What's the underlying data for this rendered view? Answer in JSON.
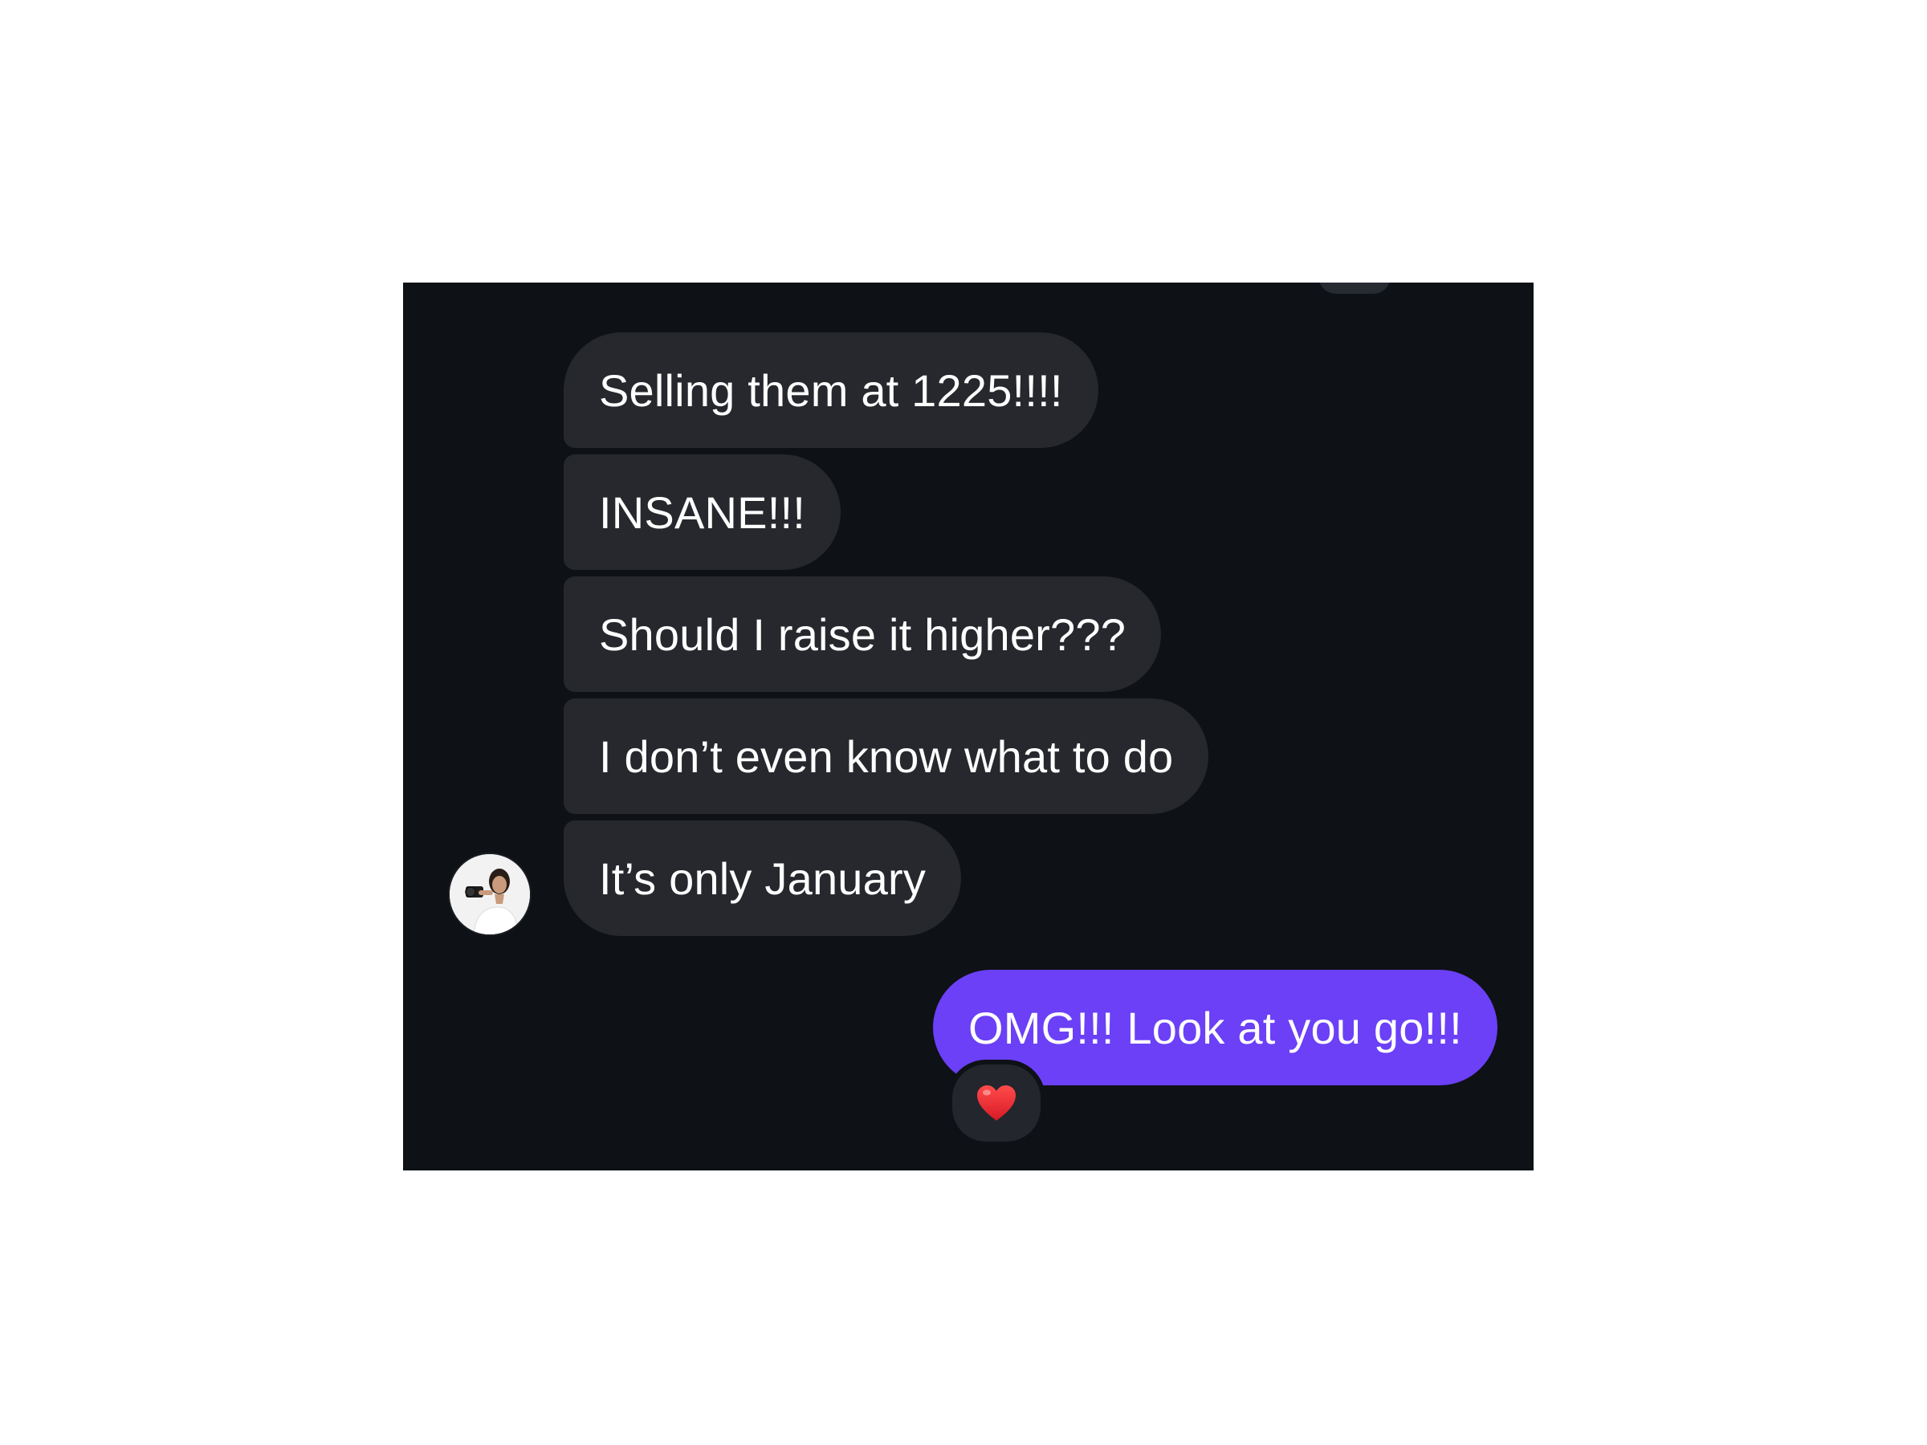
{
  "chat": {
    "incoming_messages": [
      {
        "text": "Selling them at 1225!!!!"
      },
      {
        "text": "INSANE!!!"
      },
      {
        "text": "Should I raise it higher???"
      },
      {
        "text": "I don’t even know what to do"
      },
      {
        "text": "It’s only January"
      }
    ],
    "outgoing_messages": [
      {
        "text": "OMG!!! Look at you go!!!",
        "reaction": "heart-icon"
      }
    ],
    "avatar": "profile-photo-avatar"
  },
  "colors": {
    "background": "#0e1116",
    "incoming_bubble": "#26282d",
    "outgoing_bubble": "#6b40f7",
    "text": "#ffffff",
    "reaction_heart": "#e2202c"
  }
}
